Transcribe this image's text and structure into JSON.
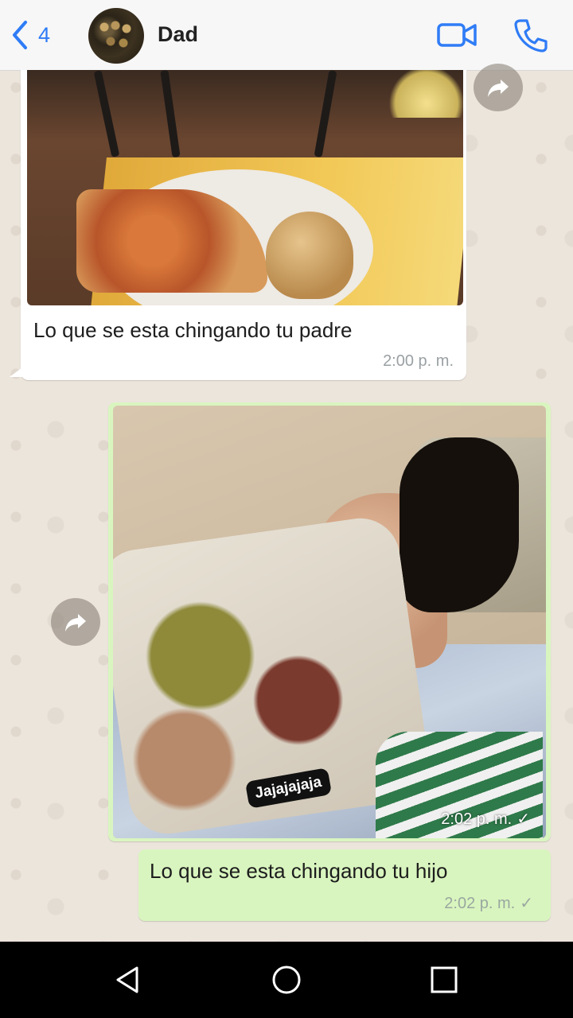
{
  "header": {
    "back_count": "4",
    "contact_name": "Dad",
    "icons": [
      "back-chevron-icon",
      "video-call-icon",
      "phone-icon"
    ]
  },
  "messages": [
    {
      "direction": "incoming",
      "type": "image-with-caption",
      "image": "photo of pizza slice and bread on a plate",
      "caption": "Lo que se esta chingando tu padre",
      "time": "2:00 p. m."
    },
    {
      "direction": "outgoing",
      "type": "image",
      "image": "photo of person lying in bed",
      "sticker_text": "Jajajajaja",
      "time": "2:02 p. m."
    },
    {
      "direction": "outgoing",
      "type": "text",
      "text": "Lo que se esta chingando tu hijo",
      "time": "2:02 p. m."
    }
  ],
  "colors": {
    "accent": "#2f7cf6",
    "outgoing_bubble": "#d9f5bf",
    "incoming_bubble": "#ffffff",
    "chat_background": "#ece5dc"
  }
}
